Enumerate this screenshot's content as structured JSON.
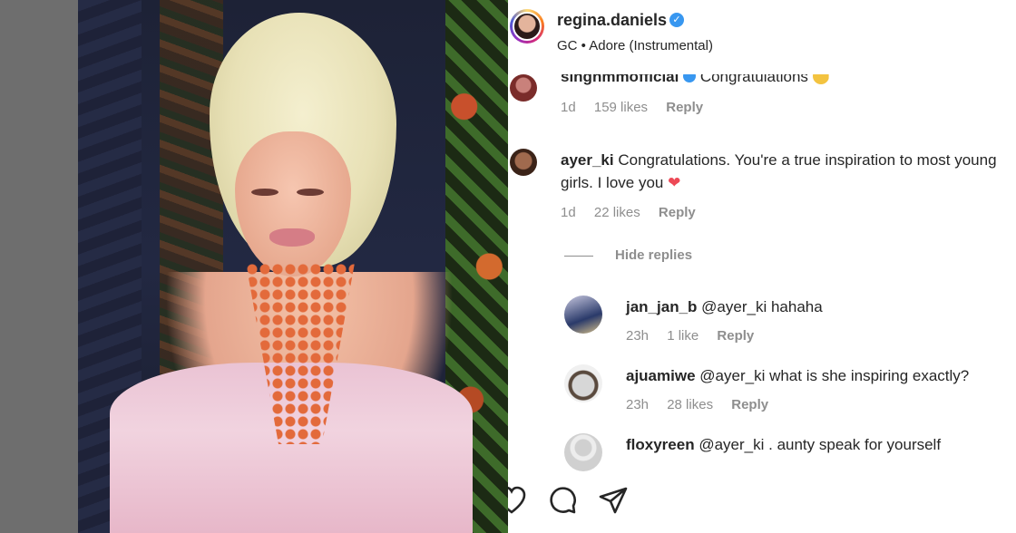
{
  "post": {
    "username": "regina.daniels",
    "verified_icon": "verified-badge-icon",
    "audio": "GC • Adore (Instrumental)"
  },
  "comments": [
    {
      "username": "singhmmofficial",
      "text": "Congratulations",
      "emoji_icon": "laughing-emoji-icon",
      "time": "1d",
      "likes": "159 likes",
      "reply": "Reply"
    },
    {
      "username": "ayer_ki",
      "text": "Congratulations. You're a true inspiration to most young girls. I love you",
      "emoji_icon": "red-heart-icon",
      "time": "1d",
      "likes": "22 likes",
      "reply": "Reply"
    }
  ],
  "hide_replies": "Hide replies",
  "replies": [
    {
      "username": "jan_jan_b",
      "mention": "@ayer_ki",
      "text": "hahaha",
      "time": "23h",
      "likes": "1 like",
      "reply": "Reply"
    },
    {
      "username": "ajuamiwe",
      "mention": "@ayer_ki",
      "text": "what is she inspiring exactly?",
      "time": "23h",
      "likes": "28 likes",
      "reply": "Reply"
    },
    {
      "username": "floxyreen",
      "mention": "@ayer_ki",
      "text": ". aunty speak for yourself"
    }
  ],
  "actions": {
    "icons": [
      "like-icon",
      "comment-icon",
      "share-icon"
    ]
  }
}
